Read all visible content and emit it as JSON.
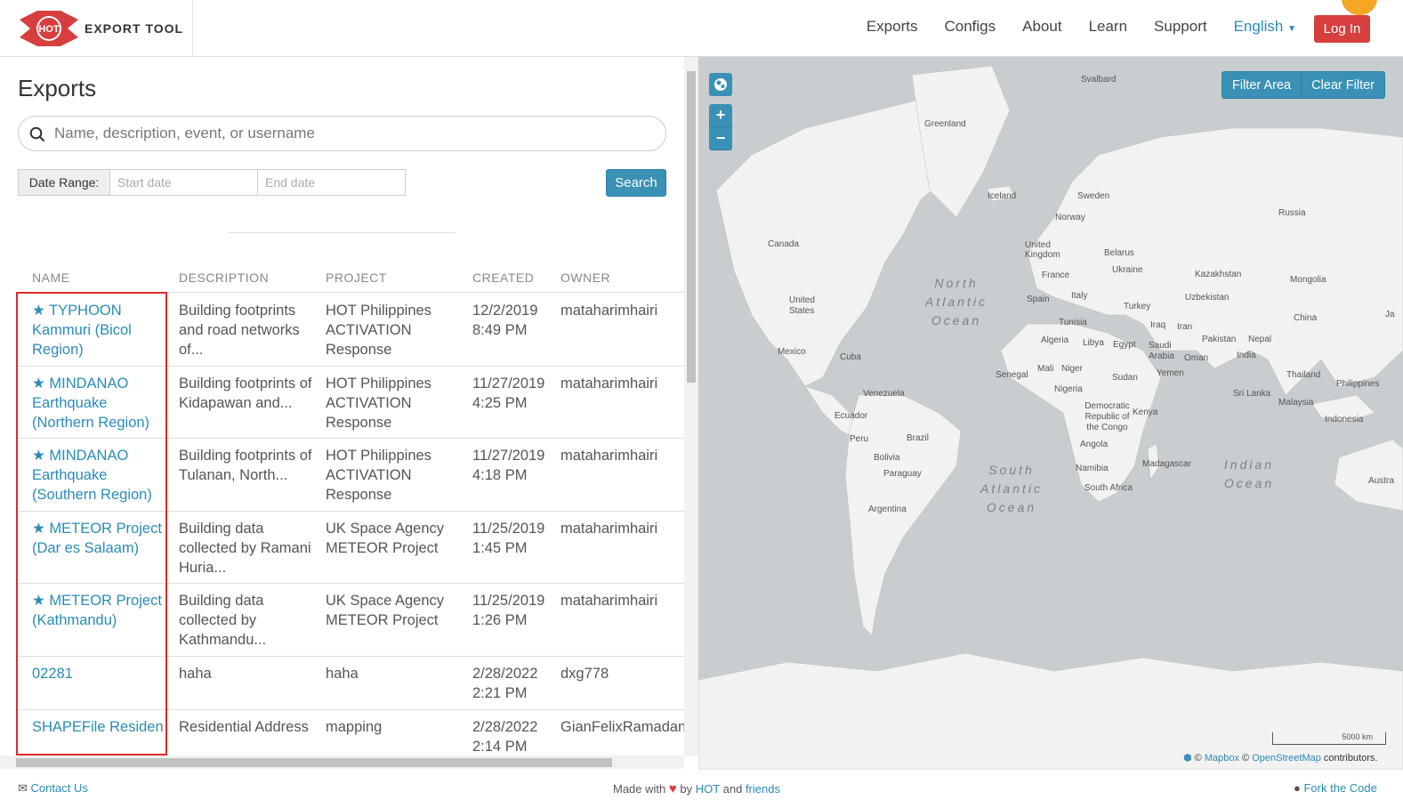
{
  "nav": {
    "logo_badge": "HOT",
    "logo_text": "EXPORT TOOL",
    "menu": [
      "Exports",
      "Configs",
      "About",
      "Learn",
      "Support"
    ],
    "language": "English",
    "login": "Log In"
  },
  "page": {
    "title": "Exports",
    "search_placeholder": "Name, description, event, or username",
    "date_range_label": "Date Range:",
    "start_placeholder": "Start date",
    "end_placeholder": "End date",
    "search_button": "Search"
  },
  "table": {
    "headers": [
      "NAME",
      "DESCRIPTION",
      "PROJECT",
      "CREATED",
      "OWNER"
    ],
    "rows": [
      {
        "name": "★ TYPHOON Kammuri (Bicol Region)",
        "description": "Building footprints and road networks of...",
        "project": "HOT Philippines ACTIVATION Response",
        "created": "12/2/2019 8:49 PM",
        "owner": "mataharimhairi"
      },
      {
        "name": "★ MINDANAO Earthquake (Northern Region)",
        "description": "Building footprints of Kidapawan and...",
        "project": "HOT Philippines ACTIVATION Response",
        "created": "11/27/2019 4:25 PM",
        "owner": "mataharimhairi"
      },
      {
        "name": "★ MINDANAO Earthquake (Southern Region)",
        "description": "Building footprints of Tulanan, North...",
        "project": "HOT Philippines ACTIVATION Response",
        "created": "11/27/2019 4:18 PM",
        "owner": "mataharimhairi"
      },
      {
        "name": "★ METEOR Project (Dar es Salaam)",
        "description": "Building data collected by Ramani Huria...",
        "project": "UK Space Agency METEOR Project",
        "created": "11/25/2019 1:45 PM",
        "owner": "mataharimhairi"
      },
      {
        "name": "★ METEOR Project (Kathmandu)",
        "description": "Building data collected by Kathmandu...",
        "project": "UK Space Agency METEOR Project",
        "created": "11/25/2019 1:26 PM",
        "owner": "mataharimhairi"
      },
      {
        "name": "02281",
        "description": "haha",
        "project": "haha",
        "created": "2/28/2022 2:21 PM",
        "owner": "dxg778"
      },
      {
        "name": "SHAPEFile Residen",
        "description": "Residential Address",
        "project": "mapping",
        "created": "2/28/2022 2:14 PM",
        "owner": "GianFelixRamadan"
      }
    ]
  },
  "map": {
    "filter_area": "Filter Area",
    "clear_filter": "Clear Filter",
    "zoom_in": "+",
    "zoom_out": "−",
    "scale": "5000 km",
    "attribution_prefix": "© ",
    "attribution_mapbox": "Mapbox",
    "attribution_mid": " © ",
    "attribution_osm": "OpenStreetMap",
    "attribution_suffix": " contributors.",
    "labels": [
      "Svalbard",
      "Greenland",
      "Iceland",
      "Sweden",
      "Norway",
      "Russia",
      "Canada",
      "United Kingdom",
      "Belarus",
      "Ukraine",
      "France",
      "Kazakhstan",
      "Mongolia",
      "Spain",
      "Italy",
      "Uzbekistan",
      "United States",
      "Turkey",
      "China",
      "Tunisia",
      "Iraq",
      "Iran",
      "Algeria",
      "Libya",
      "Egypt",
      "Pakistan",
      "Nepal",
      "Mexico",
      "Cuba",
      "Saudi Arabia",
      "Oman",
      "India",
      "Mali",
      "Niger",
      "Senegal",
      "Sudan",
      "Yemen",
      "Thailand",
      "Philippines",
      "Venezuela",
      "Nigeria",
      "Sri Lanka",
      "Ecuador",
      "Democratic Republic of the Congo",
      "Kenya",
      "Malaysia",
      "Indonesia",
      "Peru",
      "Brazil",
      "Angola",
      "Bolivia",
      "Paraguay",
      "Namibia",
      "Madagascar",
      "South Africa",
      "Argentina",
      "Austra",
      "Ja"
    ],
    "oceans": [
      "North Atlantic Ocean",
      "South Atlantic Ocean",
      "Indian Ocean"
    ]
  },
  "footer": {
    "contact": "Contact Us",
    "made_with": "Made with",
    "by": "by",
    "hot": "HOT",
    "and": "and",
    "friends": "friends",
    "fork": "Fork the Code"
  },
  "colors": {
    "accent": "#3a91b5",
    "login": "#d73f3f",
    "link": "#2a8bb6",
    "highlight": "#e02b2b"
  }
}
